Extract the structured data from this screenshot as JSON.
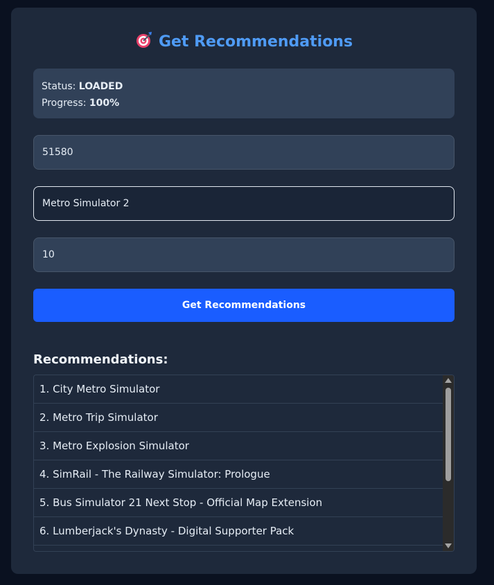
{
  "header": {
    "title": "Get Recommendations",
    "icon": "target-icon"
  },
  "status": {
    "status_label": "Status:",
    "status_value": "LOADED",
    "progress_label": "Progress:",
    "progress_value": "100%"
  },
  "form": {
    "app_id_value": "51580",
    "game_name_value": "Metro Simulator 2",
    "count_value": "10",
    "submit_label": "Get Recommendations"
  },
  "recommendations": {
    "heading": "Recommendations:",
    "items": [
      "1. City Metro Simulator",
      "2. Metro Trip Simulator",
      "3. Metro Explosion Simulator",
      "4. SimRail - The Railway Simulator: Prologue",
      "5. Bus Simulator 21 Next Stop - Official Map Extension",
      "6. Lumberjack's Dynasty - Digital Supporter Pack"
    ]
  },
  "colors": {
    "accent": "#4f9bf5",
    "button": "#1a5dff",
    "card_bg": "#1e293b",
    "page_bg": "#0a1120"
  }
}
